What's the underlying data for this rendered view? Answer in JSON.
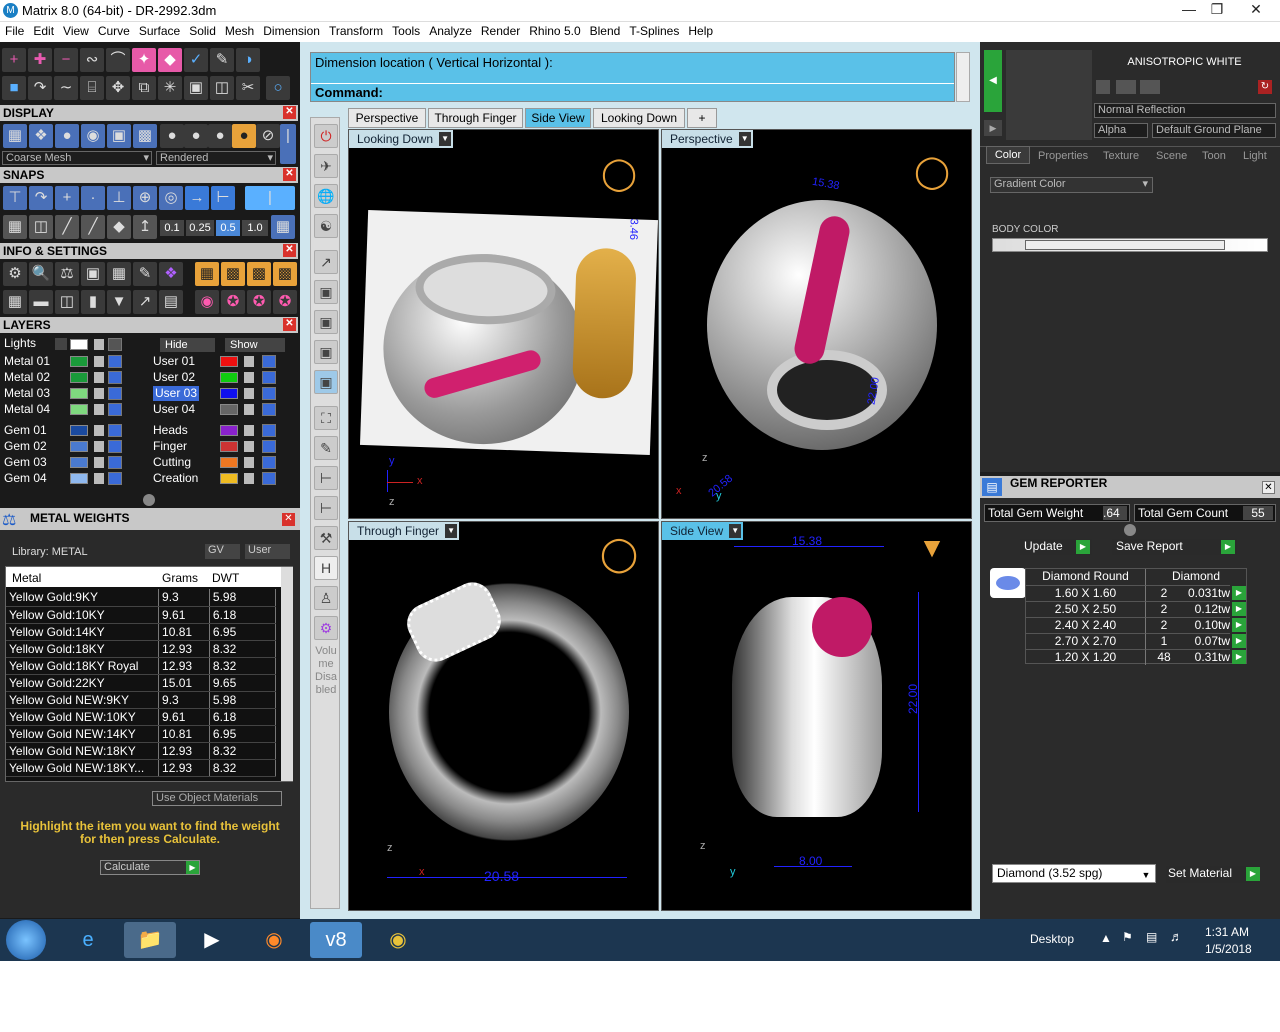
{
  "window": {
    "title": "Matrix 8.0 (64-bit) - DR-2992.3dm"
  },
  "menu": [
    "File",
    "Edit",
    "View",
    "Curve",
    "Surface",
    "Solid",
    "Mesh",
    "Dimension",
    "Transform",
    "Tools",
    "Analyze",
    "Render",
    "Blend",
    "T-Splines",
    "Help"
  ],
  "menu_extra": "Rhino 5.0",
  "display": {
    "title": "DISPLAY",
    "mesh": "Coarse Mesh",
    "mode": "Rendered"
  },
  "snaps": {
    "title": "SNAPS",
    "values": [
      "0.1",
      "0.25",
      "0.5",
      "1.0"
    ]
  },
  "info": {
    "title": "INFO & SETTINGS"
  },
  "layers": {
    "title": "LAYERS",
    "lights": "Lights",
    "hide": "Hide",
    "show": "Show",
    "left": [
      "Metal 01",
      "Metal 02",
      "Metal 03",
      "Metal 04",
      "Gem 01",
      "Gem 02",
      "Gem 03",
      "Gem 04"
    ],
    "right": [
      "User 01",
      "User 02",
      "User 03",
      "User 04",
      "Heads",
      "Finger",
      "Cutting",
      "Creation"
    ],
    "left_colors": [
      "#1a9a3a",
      "#1a9a3a",
      "#7fd87f",
      "#7fd87f",
      "#1a4aa0",
      "#4a7ad0",
      "#4a7ad0",
      "#8fb8ee"
    ],
    "right_colors": [
      "#ee1010",
      "#10cc10",
      "#1010ee",
      "#666666",
      "#8a22cc",
      "#cc3333",
      "#ee7722",
      "#eebb22"
    ]
  },
  "metal": {
    "title": "METAL WEIGHTS",
    "library": "Library: METAL",
    "gv": "GV",
    "user": "User",
    "headers": [
      "Metal",
      "Grams",
      "DWT"
    ],
    "rows": [
      [
        "Yellow Gold:9KY",
        "9.3",
        "5.98"
      ],
      [
        "Yellow Gold:10KY",
        "9.61",
        "6.18"
      ],
      [
        "Yellow Gold:14KY",
        "10.81",
        "6.95"
      ],
      [
        "Yellow Gold:18KY",
        "12.93",
        "8.32"
      ],
      [
        "Yellow Gold:18KY Royal",
        "12.93",
        "8.32"
      ],
      [
        "Yellow Gold:22KY",
        "15.01",
        "9.65"
      ],
      [
        "Yellow Gold NEW:9KY",
        "9.3",
        "5.98"
      ],
      [
        "Yellow Gold NEW:10KY",
        "9.61",
        "6.18"
      ],
      [
        "Yellow Gold NEW:14KY",
        "10.81",
        "6.95"
      ],
      [
        "Yellow Gold NEW:18KY",
        "12.93",
        "8.32"
      ],
      [
        "Yellow Gold NEW:18KY...",
        "12.93",
        "8.32"
      ]
    ],
    "use_object": "Use Object Materials",
    "hint": "Highlight the item you want to find the weight for then press Calculate.",
    "calculate": "Calculate"
  },
  "command": {
    "prompt": "Dimension location ( Vertical  Horizontal ):",
    "label": "Command:"
  },
  "tabs": [
    "Perspective",
    "Through Finger",
    "Side View",
    "Looking Down"
  ],
  "tab_add": "+",
  "viewports": {
    "tl": {
      "label": "Looking Down",
      "dim": "3.46"
    },
    "tr": {
      "label": "Perspective",
      "dims": [
        "15.38",
        "22.00",
        "20.58"
      ]
    },
    "bl": {
      "label": "Through Finger",
      "dim": "20.58"
    },
    "br": {
      "label": "Side View",
      "dims": [
        "15.38",
        "22.00",
        "8.00"
      ]
    }
  },
  "axes": {
    "tl": [
      "y",
      "x",
      "z"
    ],
    "tr": [
      "z",
      "x",
      "y"
    ],
    "bl": [
      "z",
      "x"
    ],
    "br": [
      "z",
      "y"
    ]
  },
  "vstrip_label": "Volume Disabled",
  "material": {
    "name": "ANISOTROPIC WHITE",
    "reflection": "Normal Reflection",
    "alpha": "Alpha",
    "ground": "Default Ground Plane",
    "tabs": [
      "Color",
      "Properties",
      "Texture",
      "Scene",
      "Toon",
      "Light"
    ],
    "gradient": "Gradient Color",
    "body_color": "BODY COLOR"
  },
  "gem": {
    "title": "GEM REPORTER",
    "weight_label": "Total Gem Weight",
    "weight": ".64",
    "count_label": "Total Gem Count",
    "count": "55",
    "update": "Update",
    "save": "Save Report",
    "headers": [
      "Diamond Round",
      "Diamond"
    ],
    "rows": [
      [
        "1.60 X 1.60",
        "2",
        "0.031tw"
      ],
      [
        "2.50 X 2.50",
        "2",
        "0.12tw"
      ],
      [
        "2.40 X 2.40",
        "2",
        "0.10tw"
      ],
      [
        "2.70 X 2.70",
        "1",
        "0.07tw"
      ],
      [
        "1.20 X 1.20",
        "48",
        "0.31tw"
      ]
    ],
    "material_select": "Diamond    (3.52 spg)",
    "set_material": "Set Material"
  },
  "taskbar": {
    "desktop": "Desktop",
    "time": "1:31 AM",
    "date": "1/5/2018"
  }
}
